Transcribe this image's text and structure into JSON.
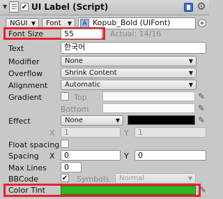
{
  "component": {
    "title": "UI Label (Script)",
    "enabled": true
  },
  "font_row": {
    "font_type_label": "NGUI",
    "font_select_label": "Font",
    "font_name": "Kopub_Bold (UIFont)"
  },
  "font_size": {
    "label": "Font Size",
    "value": "55",
    "actual": "Actual: 14/16"
  },
  "text": {
    "label": "Text",
    "value": "한국어"
  },
  "modifier": {
    "label": "Modifier",
    "value": "None"
  },
  "overflow": {
    "label": "Overflow",
    "value": "Shrink Content"
  },
  "alignment": {
    "label": "Alignment",
    "value": "Automatic"
  },
  "gradient": {
    "label": "Gradient",
    "top_label": "Top",
    "bottom_label": "Bottom",
    "enabled": false
  },
  "effect": {
    "label": "Effect",
    "value": "None",
    "x_label": "X",
    "x_value": "1",
    "y_label": "Y",
    "y_value": "1",
    "color": "#000000"
  },
  "float_spacing": {
    "label": "Float spacing",
    "checked": false
  },
  "spacing": {
    "label": "Spacing",
    "x_label": "X",
    "x_value": "0",
    "y_label": "Y",
    "y_value": "0"
  },
  "max_lines": {
    "label": "Max Lines",
    "value": "0"
  },
  "bbcode": {
    "label": "BBCode",
    "checked": true,
    "symbols_label": "Symbols",
    "symbols_value": "Normal"
  },
  "color_tint": {
    "label": "Color Tint",
    "color": "#2fb52a"
  },
  "colors": {
    "highlight": "#e8202a",
    "panel": "#c8c8c8"
  }
}
